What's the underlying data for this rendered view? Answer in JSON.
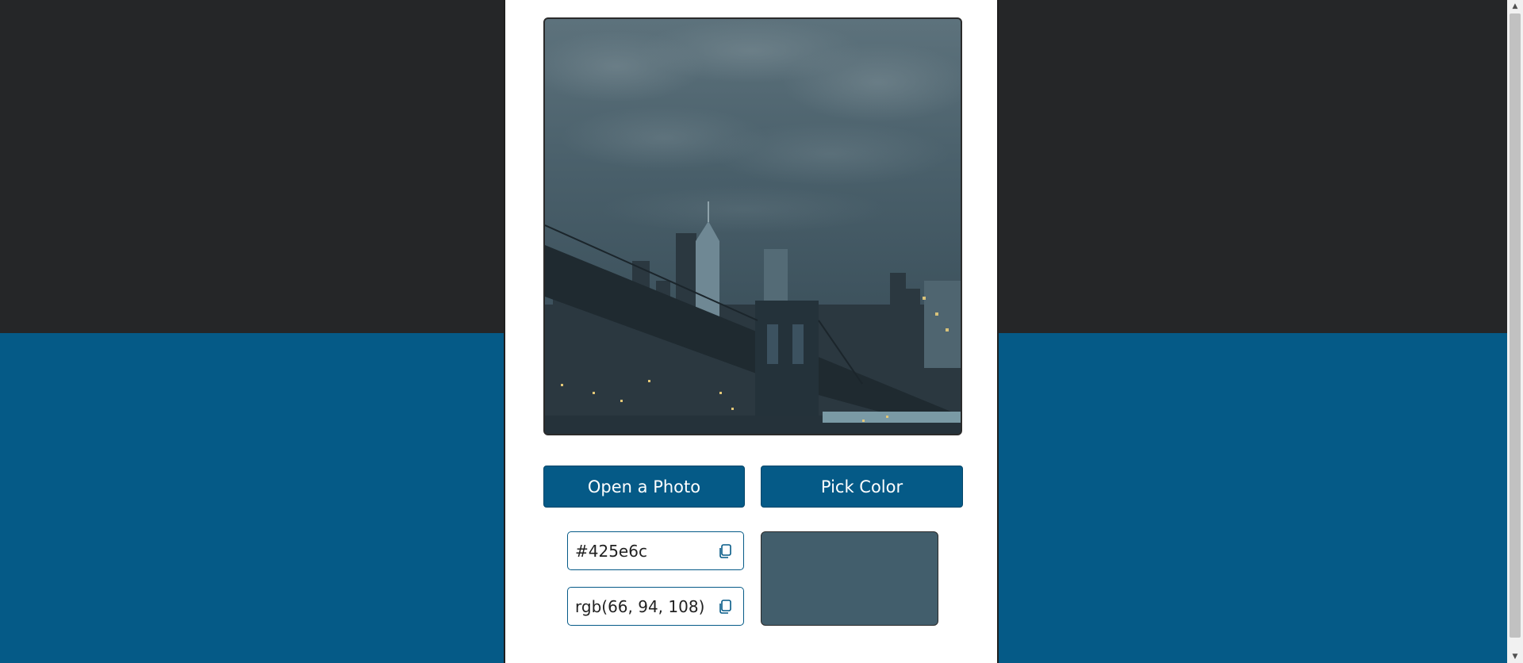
{
  "colors": {
    "page_top": "#252628",
    "page_bottom": "#055a87",
    "accent": "#055a87",
    "picked_color": "#425e6c"
  },
  "buttons": {
    "open_photo_label": "Open a Photo",
    "pick_color_label": "Pick Color"
  },
  "result": {
    "hex_value": "#425e6c",
    "rgb_value": "rgb(66, 94, 108)"
  },
  "icons": {
    "copy": "copy-icon",
    "scroll_up": "scroll-up-arrow-icon",
    "scroll_down": "scroll-down-arrow-icon"
  }
}
